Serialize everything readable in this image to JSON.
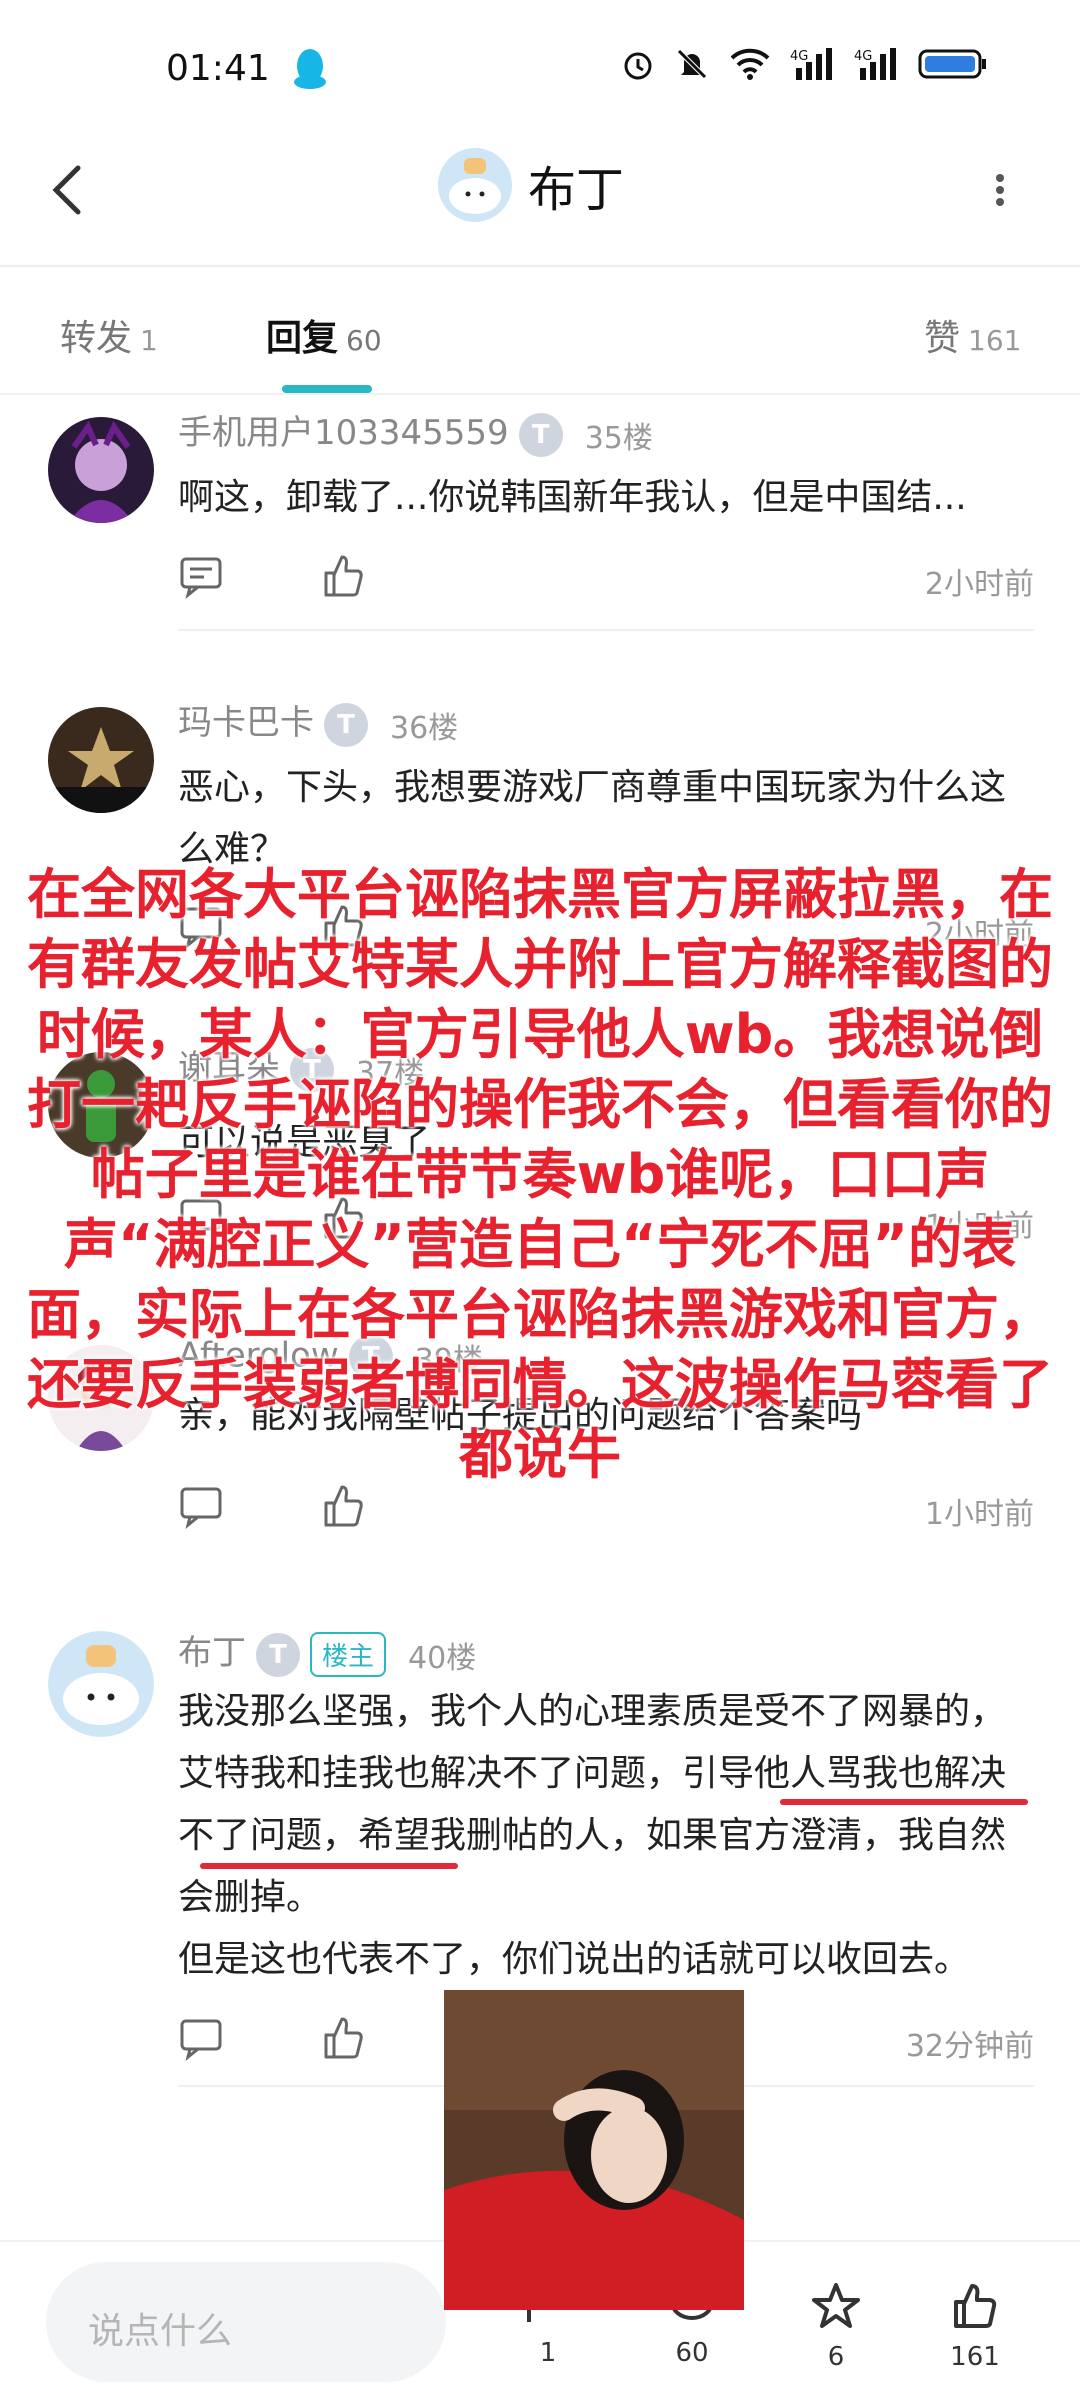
{
  "status": {
    "time": "01:41"
  },
  "header": {
    "title": "布丁"
  },
  "tabs": [
    {
      "label": "转发",
      "count": "1"
    },
    {
      "label": "回复",
      "count": "60"
    },
    {
      "label": "赞",
      "count": "161"
    }
  ],
  "posts": [
    {
      "user": "手机用户103345559",
      "badge": "T",
      "floor": "35楼",
      "content": "啊这，卸载了...你说韩国新年我认，但是中国结...",
      "time": "2小时前"
    },
    {
      "user": "玛卡巴卡",
      "badge": "T",
      "floor": "36楼",
      "content": "恶心，下头，我想要游戏厂商尊重中国玩家为什么这么难？",
      "time": "2小时前"
    },
    {
      "user": "谢耳朵",
      "badge": "T",
      "floor": "37楼",
      "content": "可以说是恶臭了",
      "time": "1小时前"
    },
    {
      "user": "Afterglow",
      "badge": "T",
      "floor": "39楼",
      "content": "亲，能对我隔壁帖子提出的问题给个答案吗",
      "time": "1小时前"
    },
    {
      "user": "布丁",
      "badge": "T",
      "owner": "楼主",
      "floor": "40楼",
      "content_line1": "我没那么坚强，我个人的心理素质是受不了网暴的，艾特我和挂我也解决不了问题，引导他人骂我也解决不了问题，希望我删帖的人，如果官方澄清，我自然会删掉。",
      "content_line2": "但是这也代表不了，你们说出的话就可以收回去。",
      "time": "32分钟前"
    }
  ],
  "overlay_text": "在全网各大平台诬陷抹黑官方屏蔽拉黑，在有群友发帖艾特某人并附上官方解释截图的时候，某人：官方引导他人wb。我想说倒打一耙反手诬陷的操作我不会，但看看你的帖子里是谁在带节奏wb谁呢，口口声声“满腔正义”营造自己“宁死不屈”的表面，实际上在各平台诬陷抹黑游戏和官方，还要反手装弱者博同情。这波操作马蓉看了都说牛",
  "bottom": {
    "placeholder": "说点什么",
    "share_count": "1",
    "comment_count": "60",
    "star_count": "6",
    "like_count": "161"
  },
  "colors": {
    "accent": "#2ab7c4",
    "overlay_red": "#e8212f"
  }
}
